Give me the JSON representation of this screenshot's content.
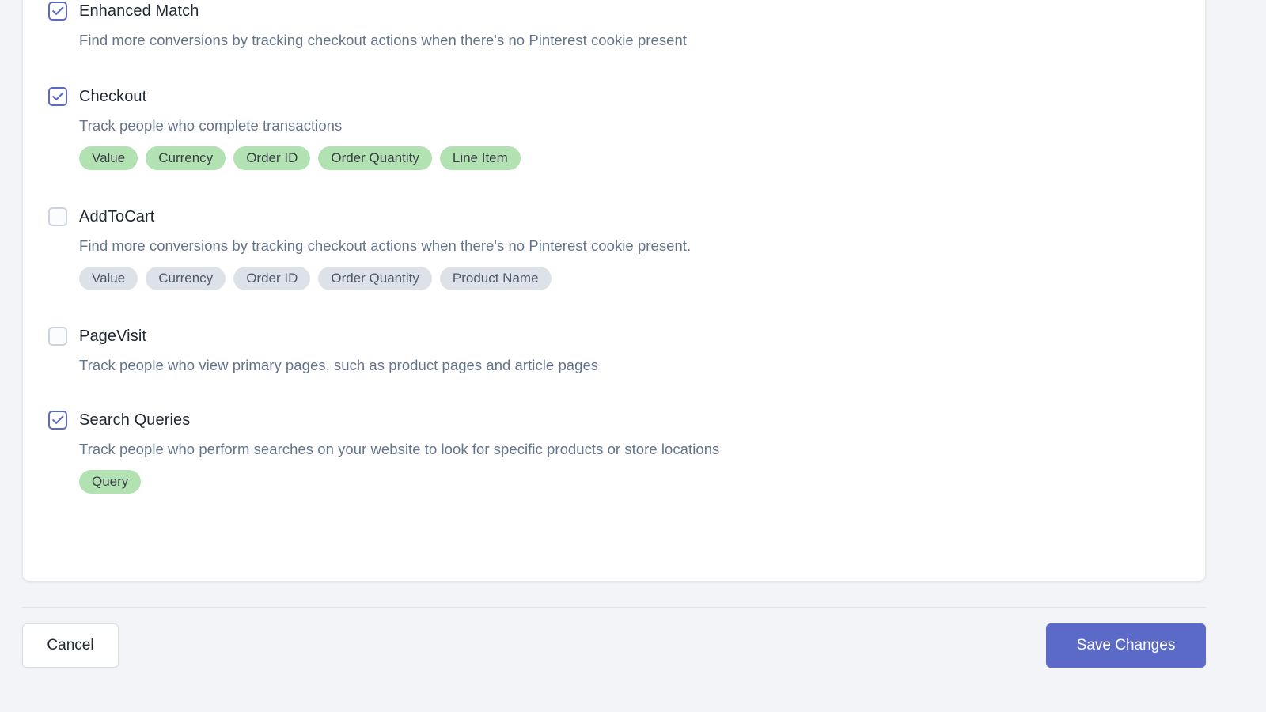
{
  "card": {
    "events": [
      {
        "id": "enhanced-match",
        "title": "Enhanced Match",
        "description": "Find more conversions by tracking checkout actions when there's no Pinterest cookie present",
        "checked": true,
        "tags": []
      },
      {
        "id": "checkout",
        "title": "Checkout",
        "description": "Track people who complete transactions",
        "checked": true,
        "tag_style": "green",
        "tags": [
          "Value",
          "Currency",
          "Order ID",
          "Order Quantity",
          "Line Item"
        ]
      },
      {
        "id": "addtocart",
        "title": "AddToCart",
        "description": "Find more conversions by tracking checkout actions when there's no Pinterest cookie present.",
        "checked": false,
        "tag_style": "gray",
        "tags": [
          "Value",
          "Currency",
          "Order ID",
          "Order Quantity",
          "Product Name"
        ]
      },
      {
        "id": "pagevisit",
        "title": "PageVisit",
        "description": "Track people who view primary pages, such as product pages and article pages",
        "checked": false,
        "tags": []
      },
      {
        "id": "search-queries",
        "title": "Search Queries",
        "description": "Track people who perform searches on your website to look for specific products or store locations",
        "checked": true,
        "tag_style": "green",
        "tags": [
          "Query"
        ]
      }
    ]
  },
  "footer": {
    "cancel_label": "Cancel",
    "save_label": "Save Changes"
  },
  "colors": {
    "accent": "#5b6ac7",
    "tag_green_bg": "#b3e2b2",
    "tag_gray_bg": "#dde1e8",
    "page_bg": "#f2f4f7",
    "card_bg": "#ffffff",
    "title_text": "#1f2733",
    "desc_text": "#64748b"
  },
  "icons": {
    "checkmark": "check-icon"
  }
}
